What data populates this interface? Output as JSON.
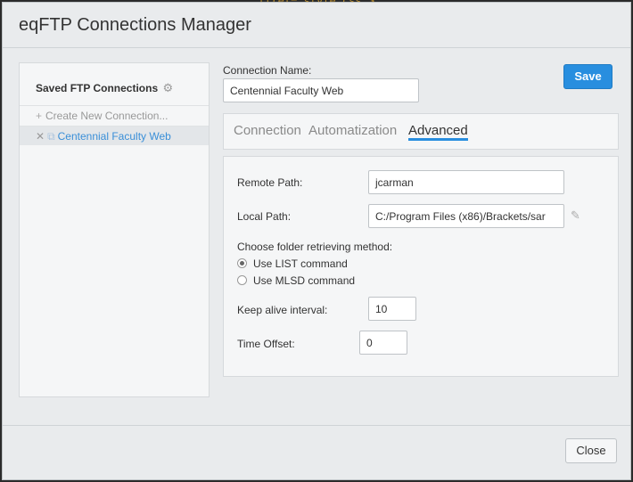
{
  "background": {
    "code_fragment": "ttrel=\"style.css\">"
  },
  "dialog": {
    "title": "eqFTP Connections Manager",
    "close_label": "Close"
  },
  "sidebar": {
    "heading": "Saved FTP Connections",
    "heading_icon": "gear-icon",
    "new_connection_label": "Create New Connection...",
    "connections": [
      {
        "label": "Centennial Faculty Web",
        "selected": true
      }
    ]
  },
  "form": {
    "connection_name_label": "Connection Name:",
    "connection_name_value": "Centennial Faculty Web",
    "save_label": "Save",
    "tabs": [
      {
        "label": "Connection",
        "active": false
      },
      {
        "label": "Automatization",
        "active": false
      },
      {
        "label": "Advanced",
        "active": true
      }
    ],
    "advanced": {
      "remote_path_label": "Remote Path:",
      "remote_path_value": "jcarman",
      "local_path_label": "Local Path:",
      "local_path_value": "C:/Program Files (x86)/Brackets/sar",
      "folder_method_label": "Choose folder retrieving method:",
      "method_options": [
        {
          "label": "Use LIST command",
          "checked": true
        },
        {
          "label": "Use MLSD command",
          "checked": false
        }
      ],
      "keep_alive_label": "Keep alive interval:",
      "keep_alive_value": "10",
      "time_offset_label": "Time Offset:",
      "time_offset_value": "0"
    }
  },
  "colors": {
    "accent": "#288edf",
    "link": "#3a8fd8"
  }
}
